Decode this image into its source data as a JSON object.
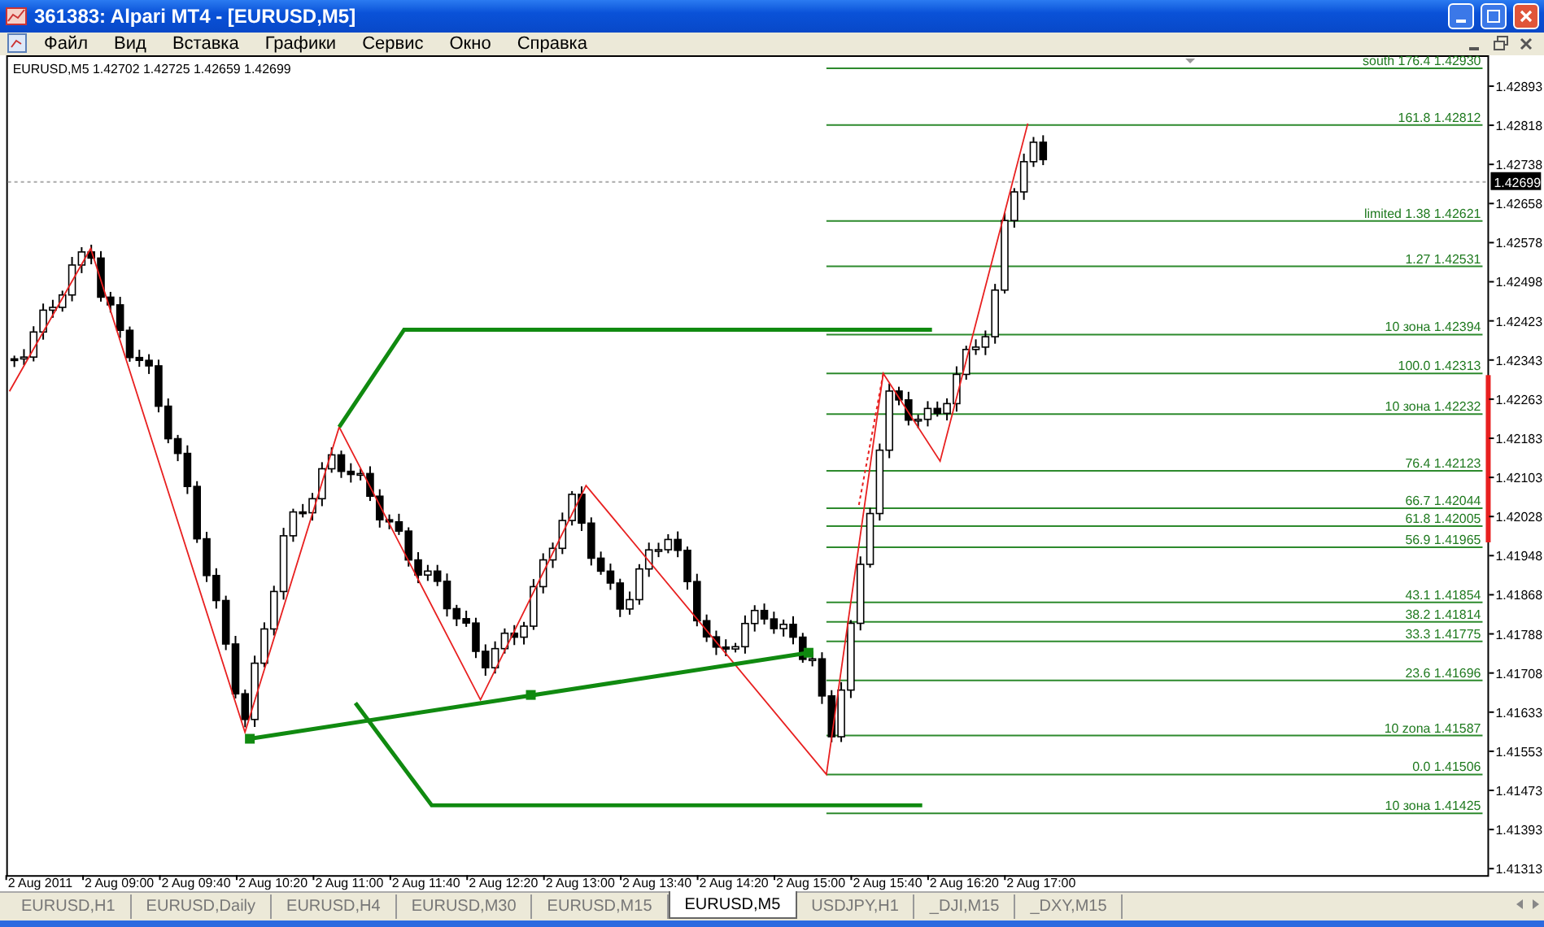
{
  "window": {
    "title": "361383: Alpari MT4 - [EURUSD,M5]"
  },
  "menu": [
    "Файл",
    "Вид",
    "Вставка",
    "Графики",
    "Сервис",
    "Окно",
    "Справка"
  ],
  "chart": {
    "header": "EURUSD,M5  1.42702 1.42725 1.42659 1.42699",
    "current_price": "1.42699",
    "price_scale": [
      "1.42893",
      "1.42818",
      "1.42738",
      "1.42658",
      "1.42578",
      "1.42498",
      "1.42423",
      "1.42343",
      "1.42263",
      "1.42183",
      "1.42103",
      "1.42028",
      "1.41948",
      "1.41868",
      "1.41788",
      "1.41708",
      "1.41633",
      "1.41553",
      "1.41473",
      "1.41393",
      "1.41313"
    ],
    "time_scale": [
      "2 Aug 2011",
      "2 Aug 09:00",
      "2 Aug 09:40",
      "2 Aug 10:20",
      "2 Aug 11:00",
      "2 Aug 11:40",
      "2 Aug 12:20",
      "2 Aug 13:00",
      "2 Aug 13:40",
      "2 Aug 14:20",
      "2 Aug 15:00",
      "2 Aug 15:40",
      "2 Aug 16:20",
      "2 Aug 17:00"
    ],
    "fib_levels": [
      {
        "label": "south 176.4 1.42930"
      },
      {
        "label": "161.8 1.42812"
      },
      {
        "label": "limited 1.38 1.42621"
      },
      {
        "label": "1.27 1.42531"
      },
      {
        "label": "10 зона 1.42394"
      },
      {
        "label": "100.0 1.42313"
      },
      {
        "label": "10 зона 1.42232"
      },
      {
        "label": "76.4 1.42123"
      },
      {
        "label": "66.7 1.42044"
      },
      {
        "label": "61.8 1.42005"
      },
      {
        "label": "56.9 1.41965"
      },
      {
        "label": "43.1 1.41854"
      },
      {
        "label": "38.2 1.41814"
      },
      {
        "label": "33.3 1.41775"
      },
      {
        "label": "23.6 1.41696"
      },
      {
        "label": "10 zona 1.41587"
      },
      {
        "label": "0.0 1.41506"
      },
      {
        "label": "10 зона 1.41425"
      }
    ]
  },
  "tabs": [
    {
      "label": "EURUSD,H1",
      "selected": false
    },
    {
      "label": "EURUSD,Daily",
      "selected": false
    },
    {
      "label": "EURUSD,H4",
      "selected": false
    },
    {
      "label": "EURUSD,M30",
      "selected": false
    },
    {
      "label": "EURUSD,M15",
      "selected": false
    },
    {
      "label": "EURUSD,M5",
      "selected": true
    },
    {
      "label": "USDJPY,H1",
      "selected": false
    },
    {
      "label": "_DJI,M15",
      "selected": false
    },
    {
      "label": "_DXY,M15",
      "selected": false
    }
  ]
}
